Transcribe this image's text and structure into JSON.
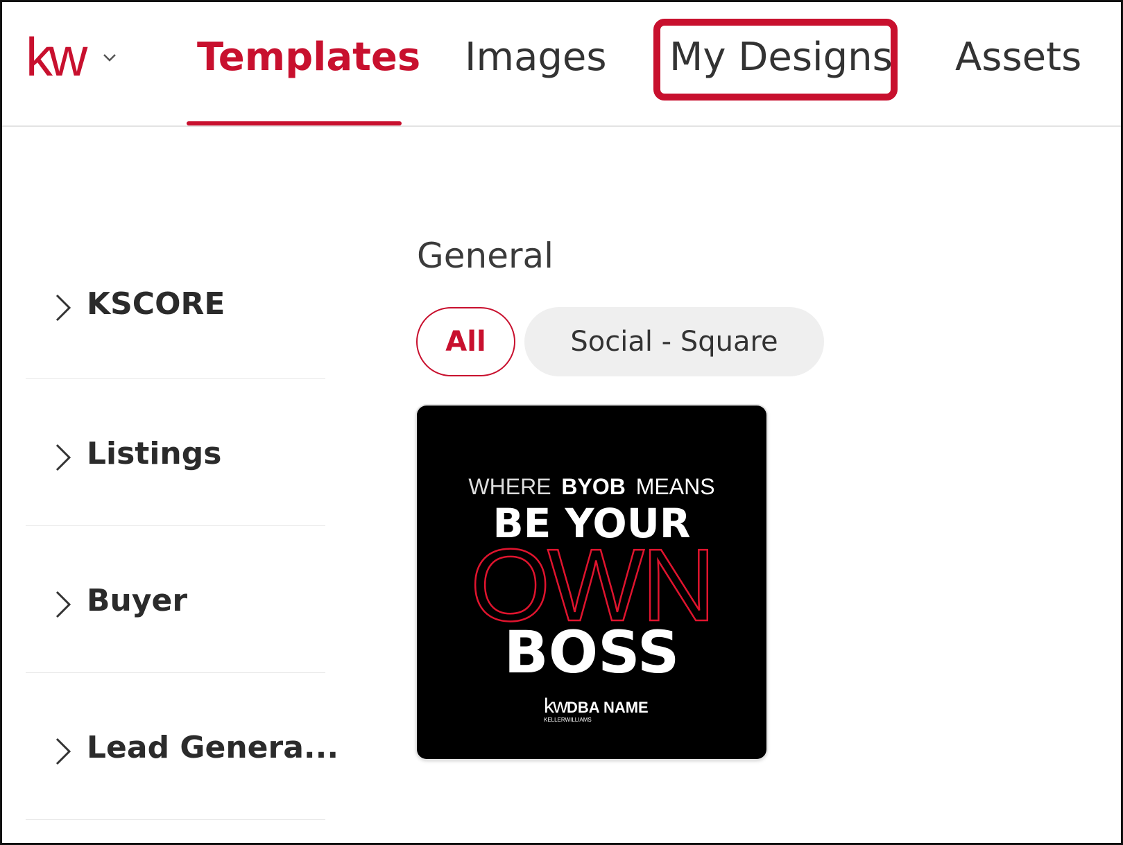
{
  "header": {
    "logo_text": "kw",
    "tabs": [
      {
        "label": "Templates",
        "active": true
      },
      {
        "label": "Images",
        "active": false
      },
      {
        "label": "My Designs",
        "active": false,
        "highlighted": true
      },
      {
        "label": "Assets",
        "active": false
      }
    ]
  },
  "sidebar": {
    "items": [
      {
        "label": "KSCORE"
      },
      {
        "label": "Listings"
      },
      {
        "label": "Buyer"
      },
      {
        "label": "Lead Genera..."
      }
    ]
  },
  "main": {
    "section_title": "General",
    "filters": [
      {
        "label": "All",
        "selected": true
      },
      {
        "label": "Social - Square",
        "selected": false
      }
    ],
    "template_card": {
      "line1_light": "WHERE",
      "line1_bold": "BYOB",
      "line1_rest": "MEANS",
      "line2": "BE YOUR",
      "line3": "OWN",
      "line4": "BOSS",
      "footer_logo": "kw",
      "footer_name": "DBA NAME",
      "footer_sub": "KELLERWILLIAMS"
    }
  },
  "colors": {
    "brand_red": "#c8102e",
    "text_dark": "#333333",
    "pill_bg": "#efefef"
  }
}
